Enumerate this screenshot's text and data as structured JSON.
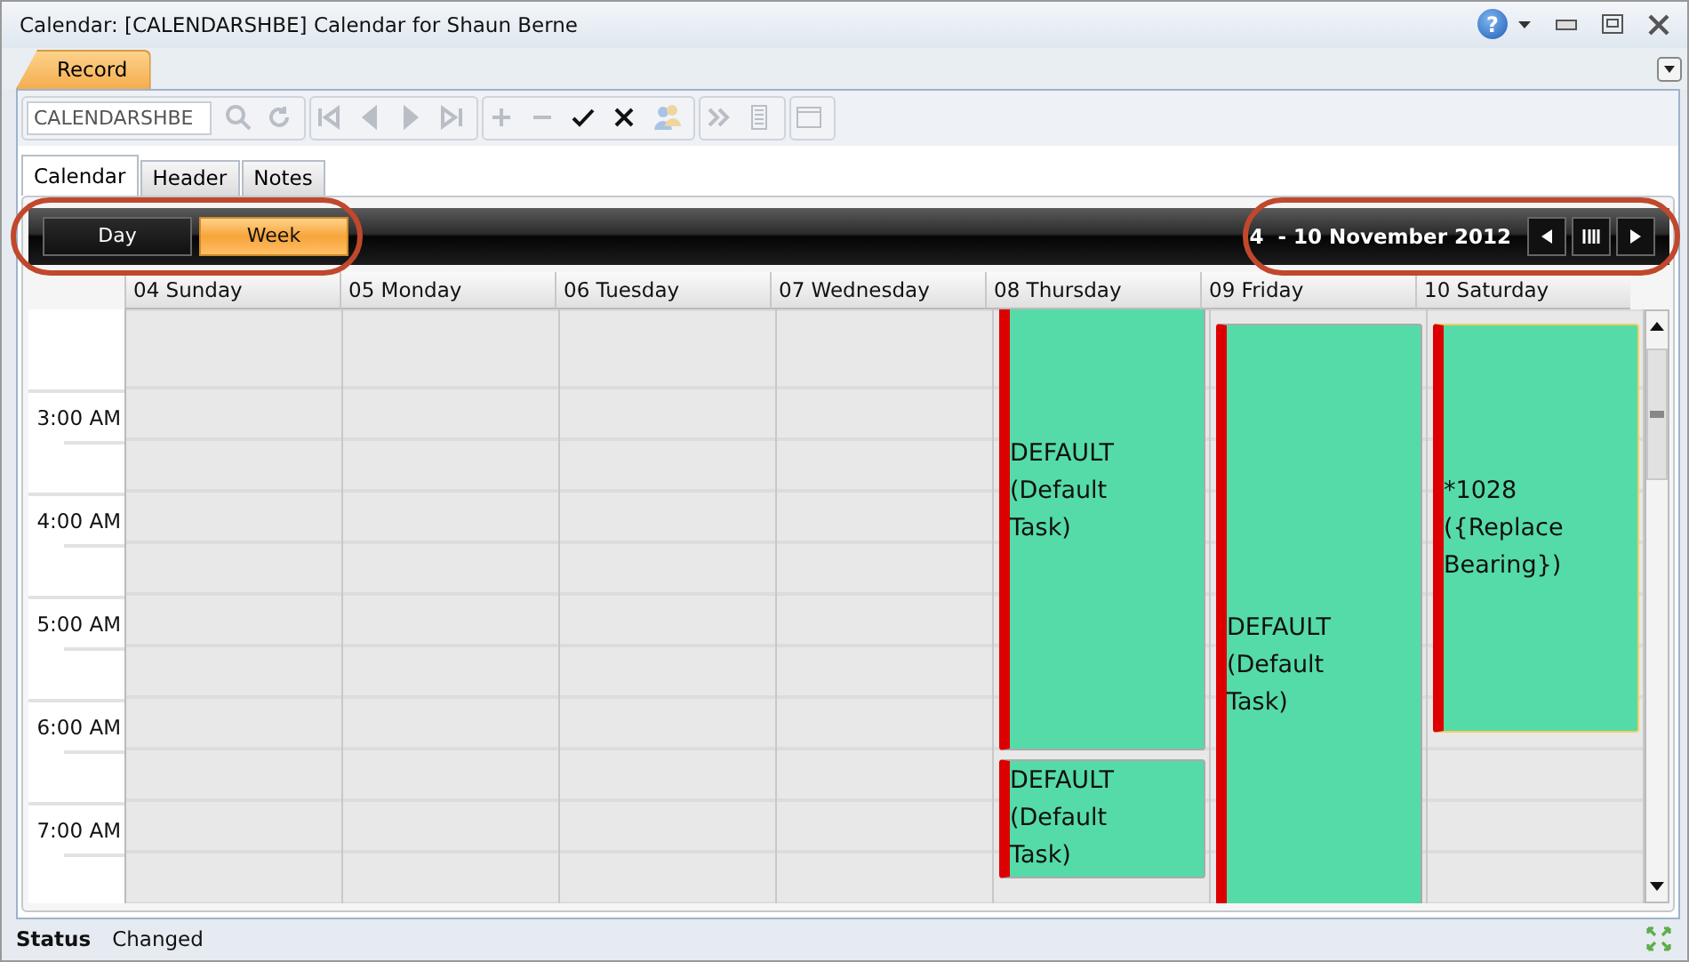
{
  "window": {
    "title": "Calendar: [CALENDARSHBE] Calendar for Shaun Berne",
    "help": "?"
  },
  "ribbon_tabs": [
    {
      "label": "Record",
      "selected": true
    }
  ],
  "toolbar": {
    "field_value": "CALENDARSHBE",
    "groups": [
      [
        {
          "kind": "search",
          "disabled": true
        },
        {
          "kind": "refresh",
          "disabled": true
        }
      ],
      [
        {
          "kind": "first",
          "disabled": true
        },
        {
          "kind": "prev",
          "disabled": true
        },
        {
          "kind": "next",
          "disabled": true
        },
        {
          "kind": "last",
          "disabled": true
        }
      ],
      [
        {
          "kind": "add",
          "disabled": true
        },
        {
          "kind": "remove",
          "disabled": true
        },
        {
          "kind": "save",
          "disabled": false
        },
        {
          "kind": "cancel",
          "disabled": false
        },
        {
          "kind": "users",
          "disabled": true
        }
      ],
      [
        {
          "kind": "more",
          "disabled": true
        },
        {
          "kind": "list",
          "disabled": true
        }
      ],
      [
        {
          "kind": "window",
          "disabled": true
        }
      ]
    ]
  },
  "tabs": [
    {
      "label": "Calendar",
      "selected": true
    },
    {
      "label": "Header",
      "selected": false
    },
    {
      "label": "Notes",
      "selected": false
    }
  ],
  "calendar": {
    "views": [
      {
        "label": "Day",
        "selected": false
      },
      {
        "label": "Week",
        "selected": true
      }
    ],
    "date_range": "4  - 10 November 2012",
    "days": [
      {
        "label": "04 Sunday"
      },
      {
        "label": "05 Monday"
      },
      {
        "label": "06 Tuesday"
      },
      {
        "label": "07 Wednesday"
      },
      {
        "label": "08 Thursday",
        "appointments": [
          {
            "text": "DEFAULT (Default Task)",
            "selected": false
          },
          {
            "text": "DEFAULT (Default Task)",
            "selected": false
          }
        ]
      },
      {
        "label": "09 Friday",
        "appointments": [
          {
            "text": "DEFAULT (Default Task)",
            "selected": false
          }
        ]
      },
      {
        "label": "10 Saturday",
        "appointments": [
          {
            "text": "*1028 ({Replace Bearing})",
            "selected": true
          }
        ]
      }
    ],
    "hours": [
      "3:00 AM",
      "4:00 AM",
      "5:00 AM",
      "6:00 AM",
      "7:00 AM"
    ]
  },
  "status_bar": {
    "label": "Status",
    "value": "Changed"
  }
}
